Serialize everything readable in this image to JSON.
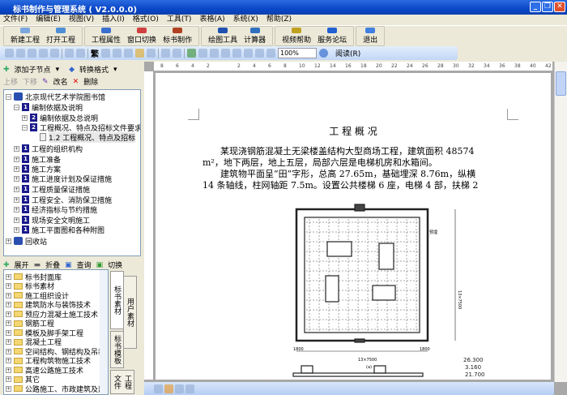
{
  "window": {
    "title": "标书制作与管理系统 ( V2.0.0.0)"
  },
  "menu": [
    "文件(F)",
    "编辑(E)",
    "视图(V)",
    "插入(I)",
    "格式(O)",
    "工具(T)",
    "表格(A)",
    "系统(X)",
    "帮助(Z)"
  ],
  "big_toolbar": [
    "新建工程",
    "打开工程",
    "工程属性",
    "窗口切换",
    "标书制作",
    "绘图工具",
    "计算器",
    "视频帮助",
    "服务论坛",
    "退出"
  ],
  "format_toolbar": {
    "trad_label": "繁",
    "zoom": "100%",
    "read_label": "阅读(R)"
  },
  "ruler": {
    "ticks": [
      "8",
      "6",
      "4",
      "2",
      "",
      "2",
      "4",
      "6",
      "8",
      "10",
      "12",
      "14",
      "16",
      "18",
      "20",
      "22",
      "24",
      "26",
      "28",
      "30",
      "32",
      "34",
      "36",
      "38",
      "40",
      "42"
    ]
  },
  "left_panel": {
    "add_child": "添加子节点",
    "convert": "转换格式",
    "move_up": "上移",
    "move_down": "下移",
    "rename": "改名",
    "delete": "删除",
    "tree": [
      {
        "label": "北京现代艺术学院图书馆",
        "level": 0
      },
      {
        "label": "编制依据及说明",
        "level": 1,
        "num": "1"
      },
      {
        "label": "编制依据及总说明",
        "level": 2,
        "num": "2"
      },
      {
        "label": "工程概况、特点及招标文件要求",
        "level": 2,
        "num": "2"
      },
      {
        "label": "1.2 工程概况、特点及招标",
        "level": 3
      },
      {
        "label": "工程的组织机构",
        "level": 1,
        "num": "1"
      },
      {
        "label": "施工准备",
        "level": 1,
        "num": "1"
      },
      {
        "label": "施工方案",
        "level": 1,
        "num": "1"
      },
      {
        "label": "施工进度计划及保证措施",
        "level": 1,
        "num": "1"
      },
      {
        "label": "工程质量保证措施",
        "level": 1,
        "num": "1"
      },
      {
        "label": "工程安全、消防保卫措施",
        "level": 1,
        "num": "1"
      },
      {
        "label": "经济指标与节约措施",
        "level": 1,
        "num": "1"
      },
      {
        "label": "现场安全文明施工",
        "level": 1,
        "num": "1"
      },
      {
        "label": "施工平面图和各种附图",
        "level": 1,
        "num": "1"
      },
      {
        "label": "回收站",
        "level": 0
      }
    ],
    "expand": "展开",
    "collapse": "折叠",
    "search": "查询",
    "switch": "切换",
    "library": [
      "标书封面库",
      "标书素材",
      "施工组织设计",
      "建筑防水与装饰技术",
      "预应力混凝土施工技术",
      "钢筋工程",
      "模板及脚手架工程",
      "混凝土工程",
      "空间结构、钢结构及吊装",
      "工程构筑物施工技术",
      "高速公路施工技术",
      "其它",
      "公路施工、市政建筑及建筑"
    ],
    "tabs": [
      "标书素材",
      "标书模板",
      "工程文件",
      "用户素材"
    ]
  },
  "document": {
    "heading": "工 程 概 况",
    "lines": [
      "某现浇钢筋混凝土无梁楼盖结构大型商场工程，建筑面积 48574",
      "m²，地下两层，地上五层，局部六层是电梯机房和水箱间。",
      "建筑物平面呈“田”字形，总高 27.65m，基础埋深 8.76m，纵横",
      "14 条轴线，柱网轴距 7.5m。设置公共楼梯 6 座，电梯 4 部，扶梯 2"
    ],
    "drawing": {
      "dim_bottom": "13×7500",
      "dim_left": "1800",
      "dim_right": "1800",
      "dim_side": "13×7500",
      "caption": "(a)",
      "label": "预埋",
      "elev1": "26.300",
      "elev2": "3.160",
      "elev3": "21.700"
    }
  }
}
